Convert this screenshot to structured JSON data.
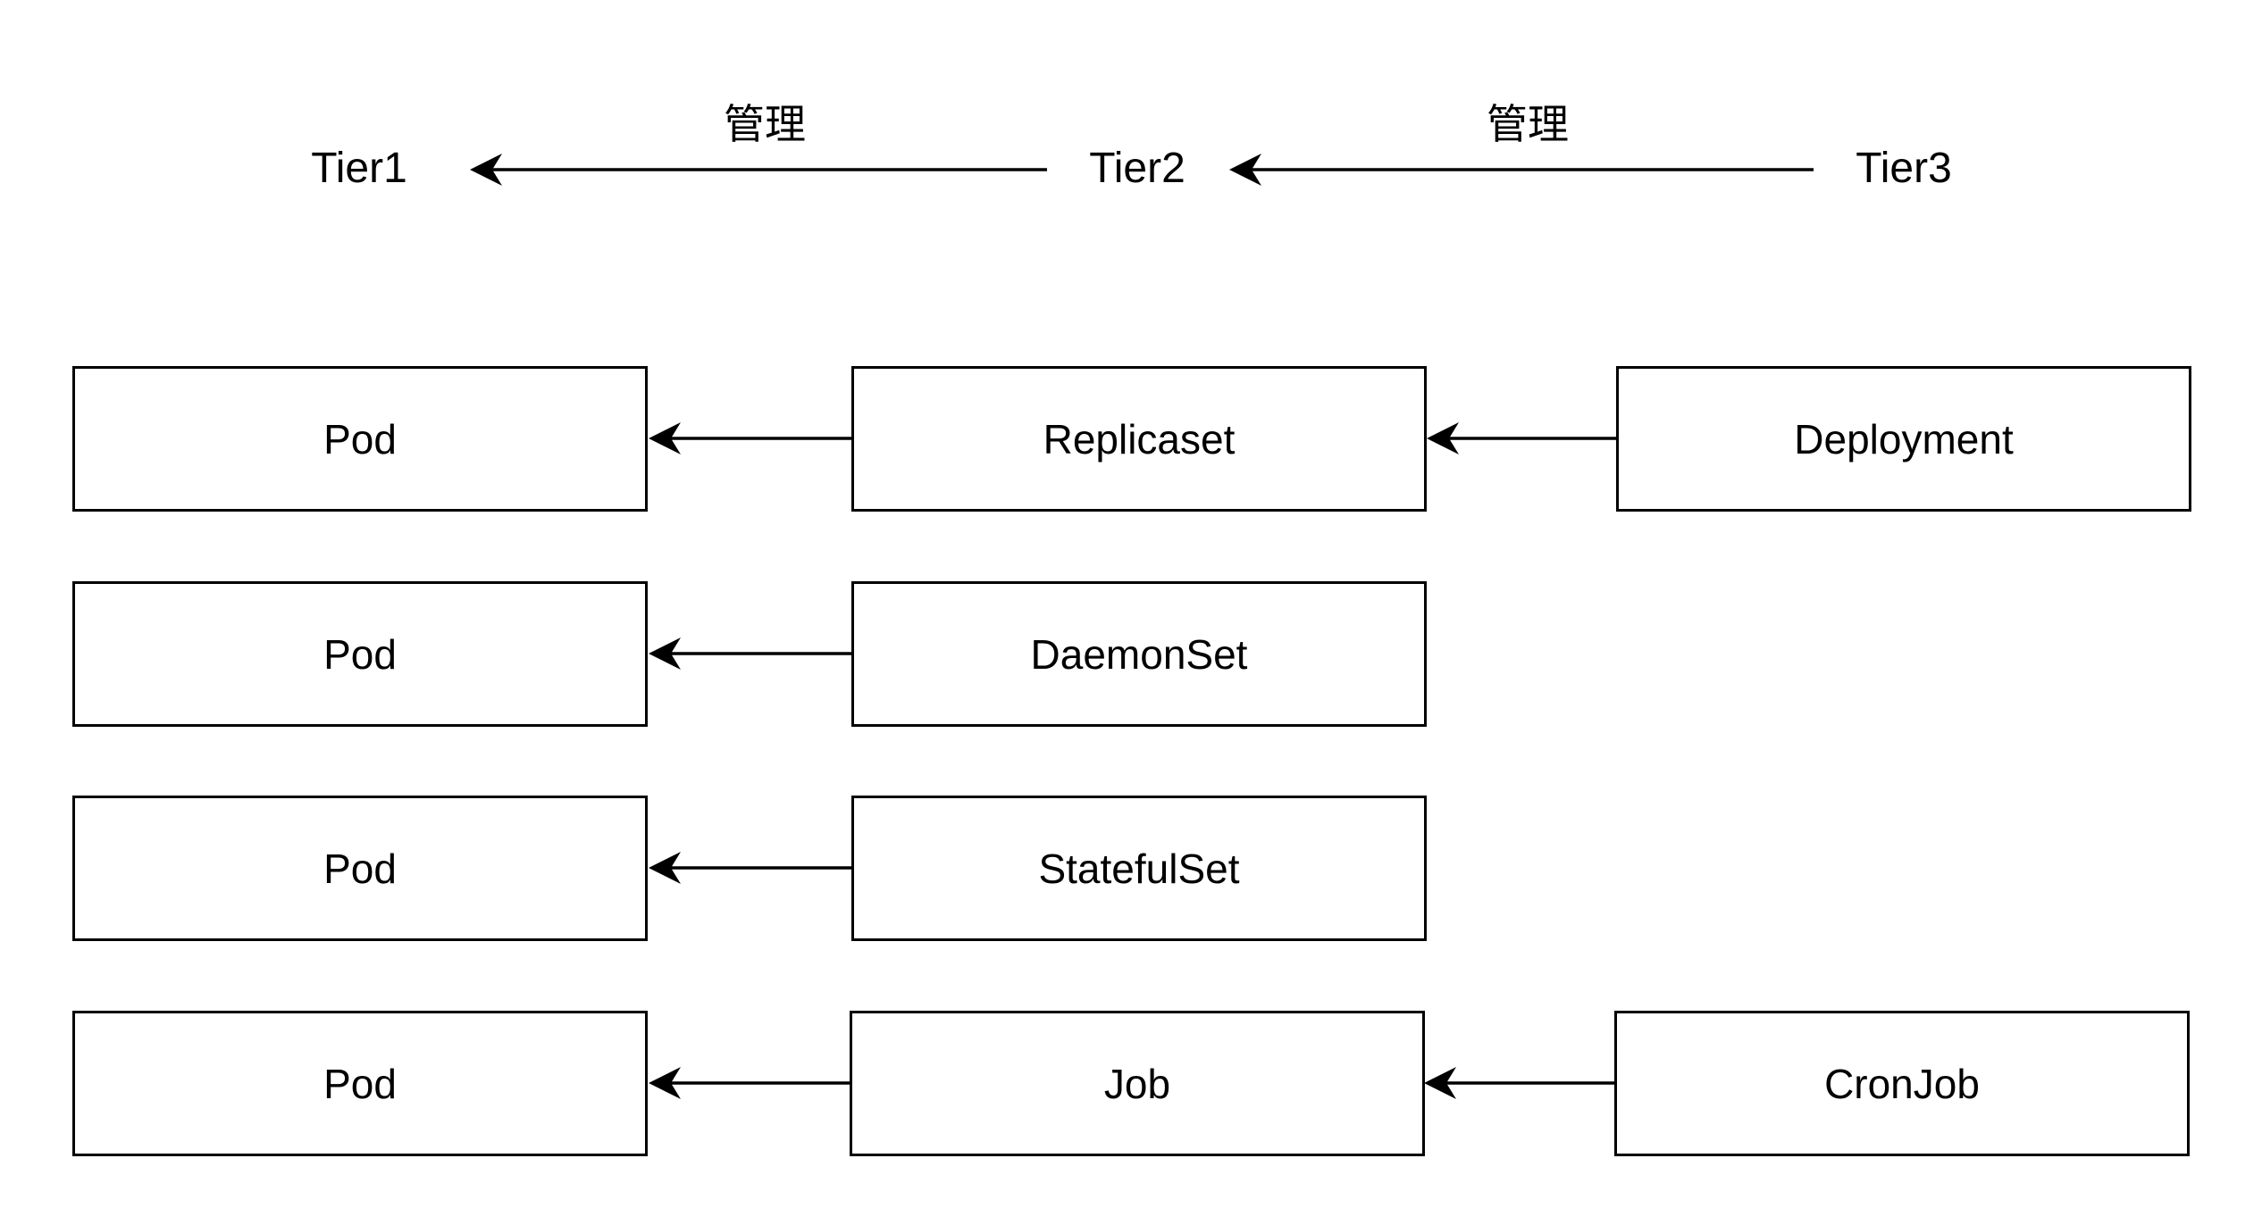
{
  "tiers": {
    "tier1": "Tier1",
    "tier2": "Tier2",
    "tier3": "Tier3",
    "edge_label_1": "管理",
    "edge_label_2": "管理"
  },
  "rows": [
    {
      "tier1": "Pod",
      "tier2": "Replicaset",
      "tier3": "Deployment"
    },
    {
      "tier1": "Pod",
      "tier2": "DaemonSet",
      "tier3": ""
    },
    {
      "tier1": "Pod",
      "tier2": "StatefulSet",
      "tier3": ""
    },
    {
      "tier1": "Pod",
      "tier2": "Job",
      "tier3": "CronJob"
    }
  ],
  "colors": {
    "stroke": "#000000",
    "background": "#ffffff"
  }
}
